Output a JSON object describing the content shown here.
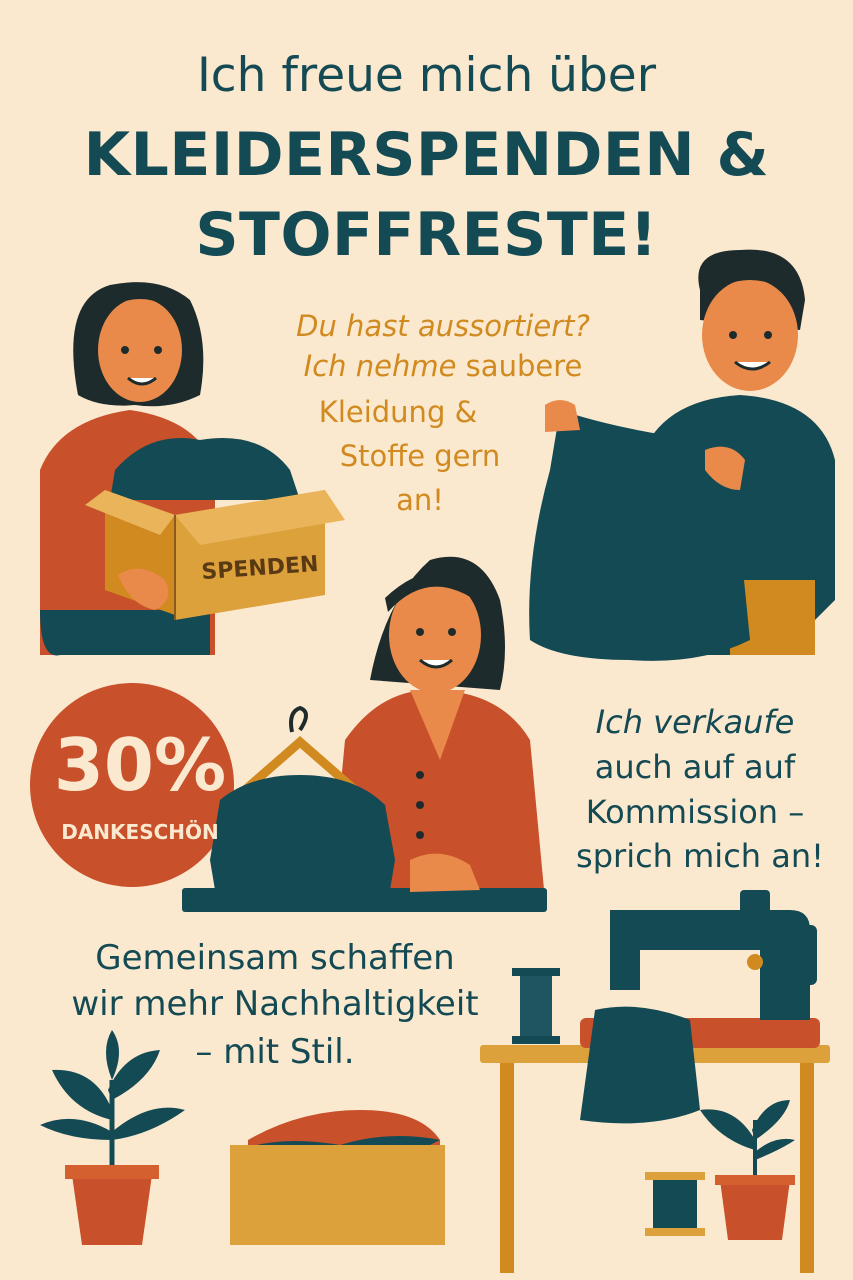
{
  "headline": {
    "line1": "Ich freue mich über",
    "line2": "KLEIDERSPENDEN &",
    "line3": "STOFFRESTE!"
  },
  "donation_text": {
    "line1": "Du hast aussortiert?",
    "line2_italic": "Ich nehme",
    "line2_rest": " saubere",
    "line3": "Kleidung &",
    "line4": "Stoffe gern",
    "line5": "an!"
  },
  "box_label": "SPENDEN",
  "badge": {
    "percent": "30%",
    "label": "DANKESCHÖN"
  },
  "commission_text": {
    "line1": "Ich verkaufe",
    "line2": "auch auf auf",
    "line3": "Kommission –",
    "line4": "sprich mich an!"
  },
  "closing_text": {
    "line1": "Gemeinsam schaffen",
    "line2": "wir mehr Nachhaltigkeit",
    "line3": "– mit Stil."
  },
  "colors": {
    "background": "#fbe9cf",
    "teal": "#144a54",
    "rust": "#c8502a",
    "ochre": "#d18a1f",
    "box": "#dda13c"
  },
  "icons": [
    "plant-icon",
    "sewing-machine-icon",
    "thread-spool-icon",
    "hanger-icon",
    "donation-box-icon"
  ]
}
